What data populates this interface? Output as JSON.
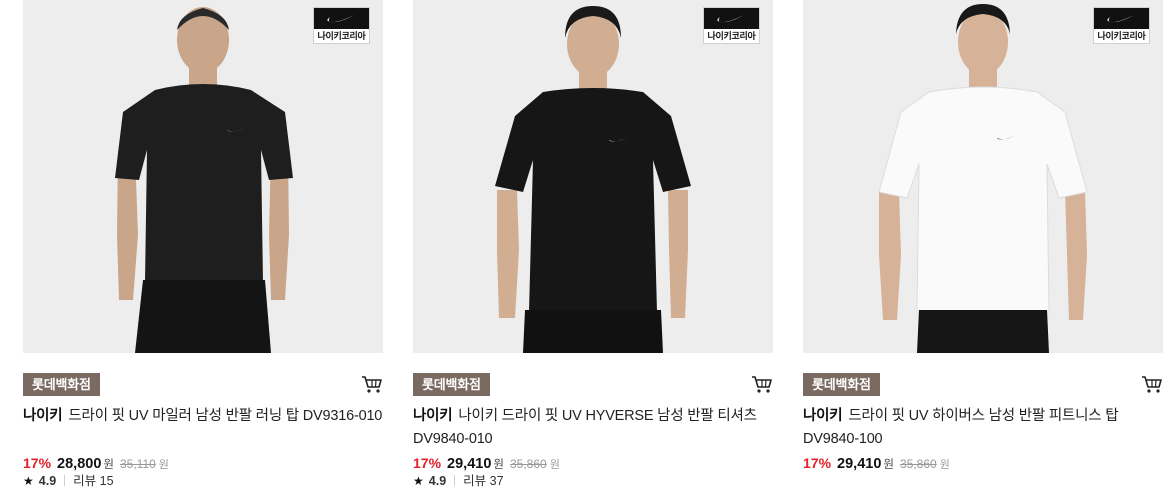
{
  "products": [
    {
      "brand_badge": "나이키코리아",
      "store": "롯데백화점",
      "brand": "나이키",
      "title": "드라이 핏 UV 마일러 남성 반팔 러닝 탑 DV9316-010",
      "discount": "17%",
      "price": "28,800",
      "currency": "원",
      "original_price": "35,110",
      "rating": "4.9",
      "reviews": "리뷰 15",
      "shirt_color": "#1e1e1e"
    },
    {
      "brand_badge": "나이키코리아",
      "store": "롯데백화점",
      "brand": "나이키",
      "title": "나이키 드라이 핏 UV HYVERSE 남성 반팔 티셔츠 DV9840-010",
      "discount": "17%",
      "price": "29,410",
      "currency": "원",
      "original_price": "35,860",
      "rating": "4.9",
      "reviews": "리뷰 37",
      "shirt_color": "#161616"
    },
    {
      "brand_badge": "나이키코리아",
      "store": "롯데백화점",
      "brand": "나이키",
      "title": "드라이 핏 UV 하이버스 남성 반팔 피트니스 탑 DV9840-100",
      "discount": "17%",
      "price": "29,410",
      "currency": "원",
      "original_price": "35,860",
      "shirt_color": "#fafafa"
    }
  ],
  "icons": {
    "cart": "cart-icon",
    "star": "star-icon",
    "brand_logo": "nike-swoosh-logo"
  },
  "colors": {
    "discount": "#e4202a",
    "store_tag": "#7b6a61"
  }
}
